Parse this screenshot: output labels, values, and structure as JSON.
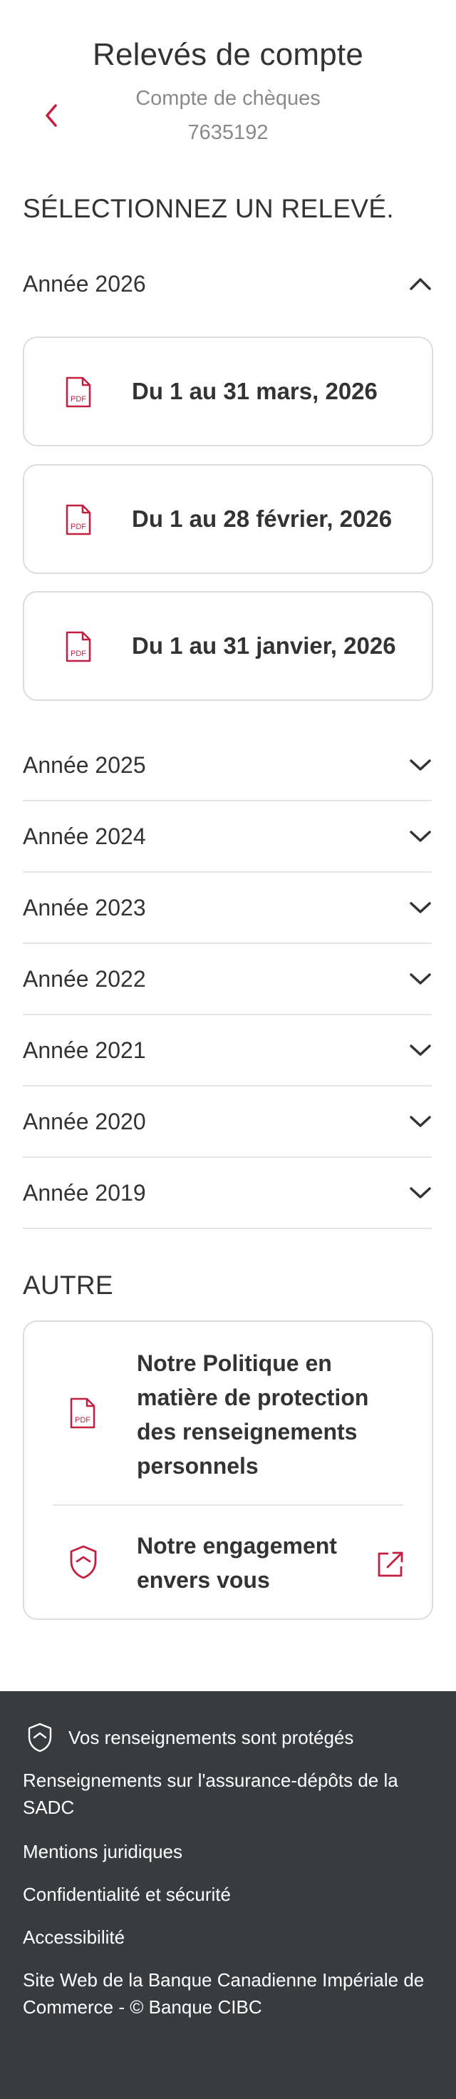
{
  "header": {
    "title": "Relevés de compte",
    "account_type": "Compte de chèques",
    "account_number": "7635192"
  },
  "colors": {
    "accent": "#c41f3e",
    "text": "#333333",
    "muted": "#8a8a8a",
    "footer_bg": "#383c3f"
  },
  "icons": {
    "back": "chevron-left-icon",
    "pdf": "pdf-icon",
    "shield": "shield-icon",
    "external": "external-link-icon"
  },
  "select_section": {
    "title": "SÉLECTIONNEZ UN RELEVÉ.",
    "expanded_year": {
      "label": "Année 2026",
      "statements": [
        {
          "label": "Du 1 au 31 mars, 2026"
        },
        {
          "label": "Du 1 au 28 février, 2026"
        },
        {
          "label": "Du 1 au 31 janvier, 2026"
        }
      ]
    },
    "collapsed_years": [
      {
        "label": "Année 2025"
      },
      {
        "label": "Année 2024"
      },
      {
        "label": "Année 2023"
      },
      {
        "label": "Année 2022"
      },
      {
        "label": "Année 2021"
      },
      {
        "label": "Année 2020"
      },
      {
        "label": "Année 2019"
      }
    ]
  },
  "other_section": {
    "title": "AUTRE",
    "items": [
      {
        "label_lines": [
          "Notre Politique en",
          "matière de protection",
          "des renseignements",
          "personnels"
        ]
      },
      {
        "label_lines": [
          "Notre engagement",
          "envers vous"
        ]
      }
    ]
  },
  "footer": {
    "protected": "Vos renseignements sont protégés",
    "links": [
      {
        "lines": [
          "Renseignements sur l'assurance-dépôts de la",
          "SADC"
        ]
      },
      {
        "lines": [
          "Mentions juridiques"
        ]
      },
      {
        "lines": [
          "Confidentialité et sécurité"
        ]
      },
      {
        "lines": [
          "Accessibilité"
        ]
      }
    ],
    "copyright_lines": [
      "Site Web de la Banque Canadienne Impériale de",
      "Commerce - © Banque CIBC"
    ]
  }
}
